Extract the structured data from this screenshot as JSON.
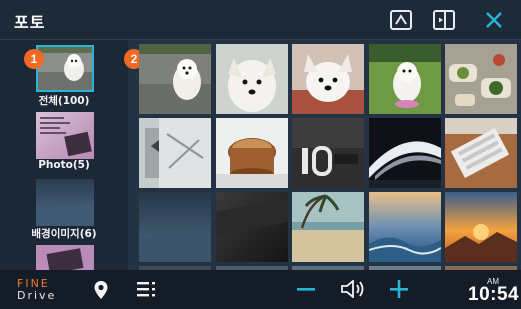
{
  "header": {
    "title": "포토",
    "buttons": [
      "up-arrow-icon",
      "split-screen-icon",
      "close-icon"
    ],
    "accent_color": "#28b4d6"
  },
  "albums": [
    {
      "label": "전체(100)",
      "selected": true
    },
    {
      "label": "Photo(5)",
      "selected": false
    },
    {
      "label": "배경이미지(6)",
      "selected": false
    },
    {
      "label": "",
      "selected": false
    }
  ],
  "callouts": {
    "one": "1",
    "two": "2",
    "color": "#f26a21"
  },
  "grid": {
    "photos": [
      "dog-on-pavement",
      "white-dog-closeup",
      "white-dog-face",
      "dog-on-grass",
      "food-table",
      "map-sign",
      "coffee-cup",
      "building-number-10",
      "curved-building",
      "keyboard-desk",
      "dark-room",
      "dark-gradient",
      "beach-palms",
      "ocean-sunset",
      "orange-sunset"
    ]
  },
  "bottom_bar": {
    "logo_top": "FINE",
    "logo_bottom": "Drive",
    "icons": [
      "location-pin-icon",
      "list-menu-icon",
      "volume-minus-icon",
      "speaker-icon",
      "volume-plus-icon"
    ],
    "ampm": "AM",
    "time": "10:54"
  }
}
